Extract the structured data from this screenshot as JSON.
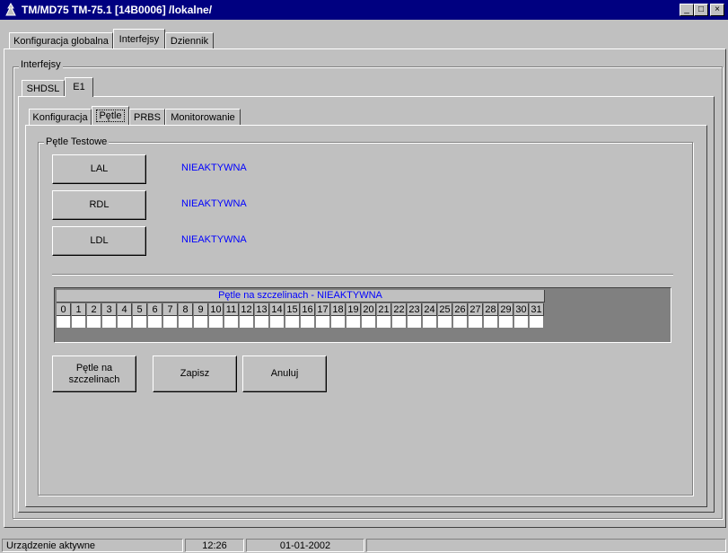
{
  "window": {
    "title": "TM/MD75 TM-75.1 [14B0006] /lokalne/",
    "minimize_glyph": "_",
    "maximize_glyph": "□",
    "close_glyph": "×"
  },
  "main_tabs": [
    {
      "label": "Konfiguracja globalna"
    },
    {
      "label": "Interfejsy"
    },
    {
      "label": "Dziennik"
    }
  ],
  "interfaces_group": {
    "label": "Interfejsy"
  },
  "iface_tabs": [
    {
      "label": "SHDSL"
    },
    {
      "label": "E1"
    }
  ],
  "e1_tabs": [
    {
      "label": "Konfiguracja"
    },
    {
      "label": "Pętle"
    },
    {
      "label": "PRBS"
    },
    {
      "label": "Monitorowanie"
    }
  ],
  "loops_group": {
    "label": "Pętle Testowe"
  },
  "loops": [
    {
      "button": "LAL",
      "status": "NIEAKTYWNA"
    },
    {
      "button": "RDL",
      "status": "NIEAKTYWNA"
    },
    {
      "button": "LDL",
      "status": "NIEAKTYWNA"
    }
  ],
  "timeslots": {
    "header": "Pętle na szczelinach  - NIEAKTYWNA",
    "numbers": [
      "0",
      "1",
      "2",
      "3",
      "4",
      "5",
      "6",
      "7",
      "8",
      "9",
      "10",
      "11",
      "12",
      "13",
      "14",
      "15",
      "16",
      "17",
      "18",
      "19",
      "20",
      "21",
      "22",
      "23",
      "24",
      "25",
      "26",
      "27",
      "28",
      "29",
      "30",
      "31"
    ]
  },
  "actions": {
    "timeslot_loops_label": "Pętle na szczelinach",
    "save_label": "Zapisz",
    "cancel_label": "Anuluj"
  },
  "statusbar": {
    "state": "Urządzenie aktywne",
    "time": "12:26",
    "date": "01-01-2002"
  },
  "colors": {
    "titlebar": "#000080",
    "status_text": "#0000ff",
    "face": "#c0c0c0"
  }
}
